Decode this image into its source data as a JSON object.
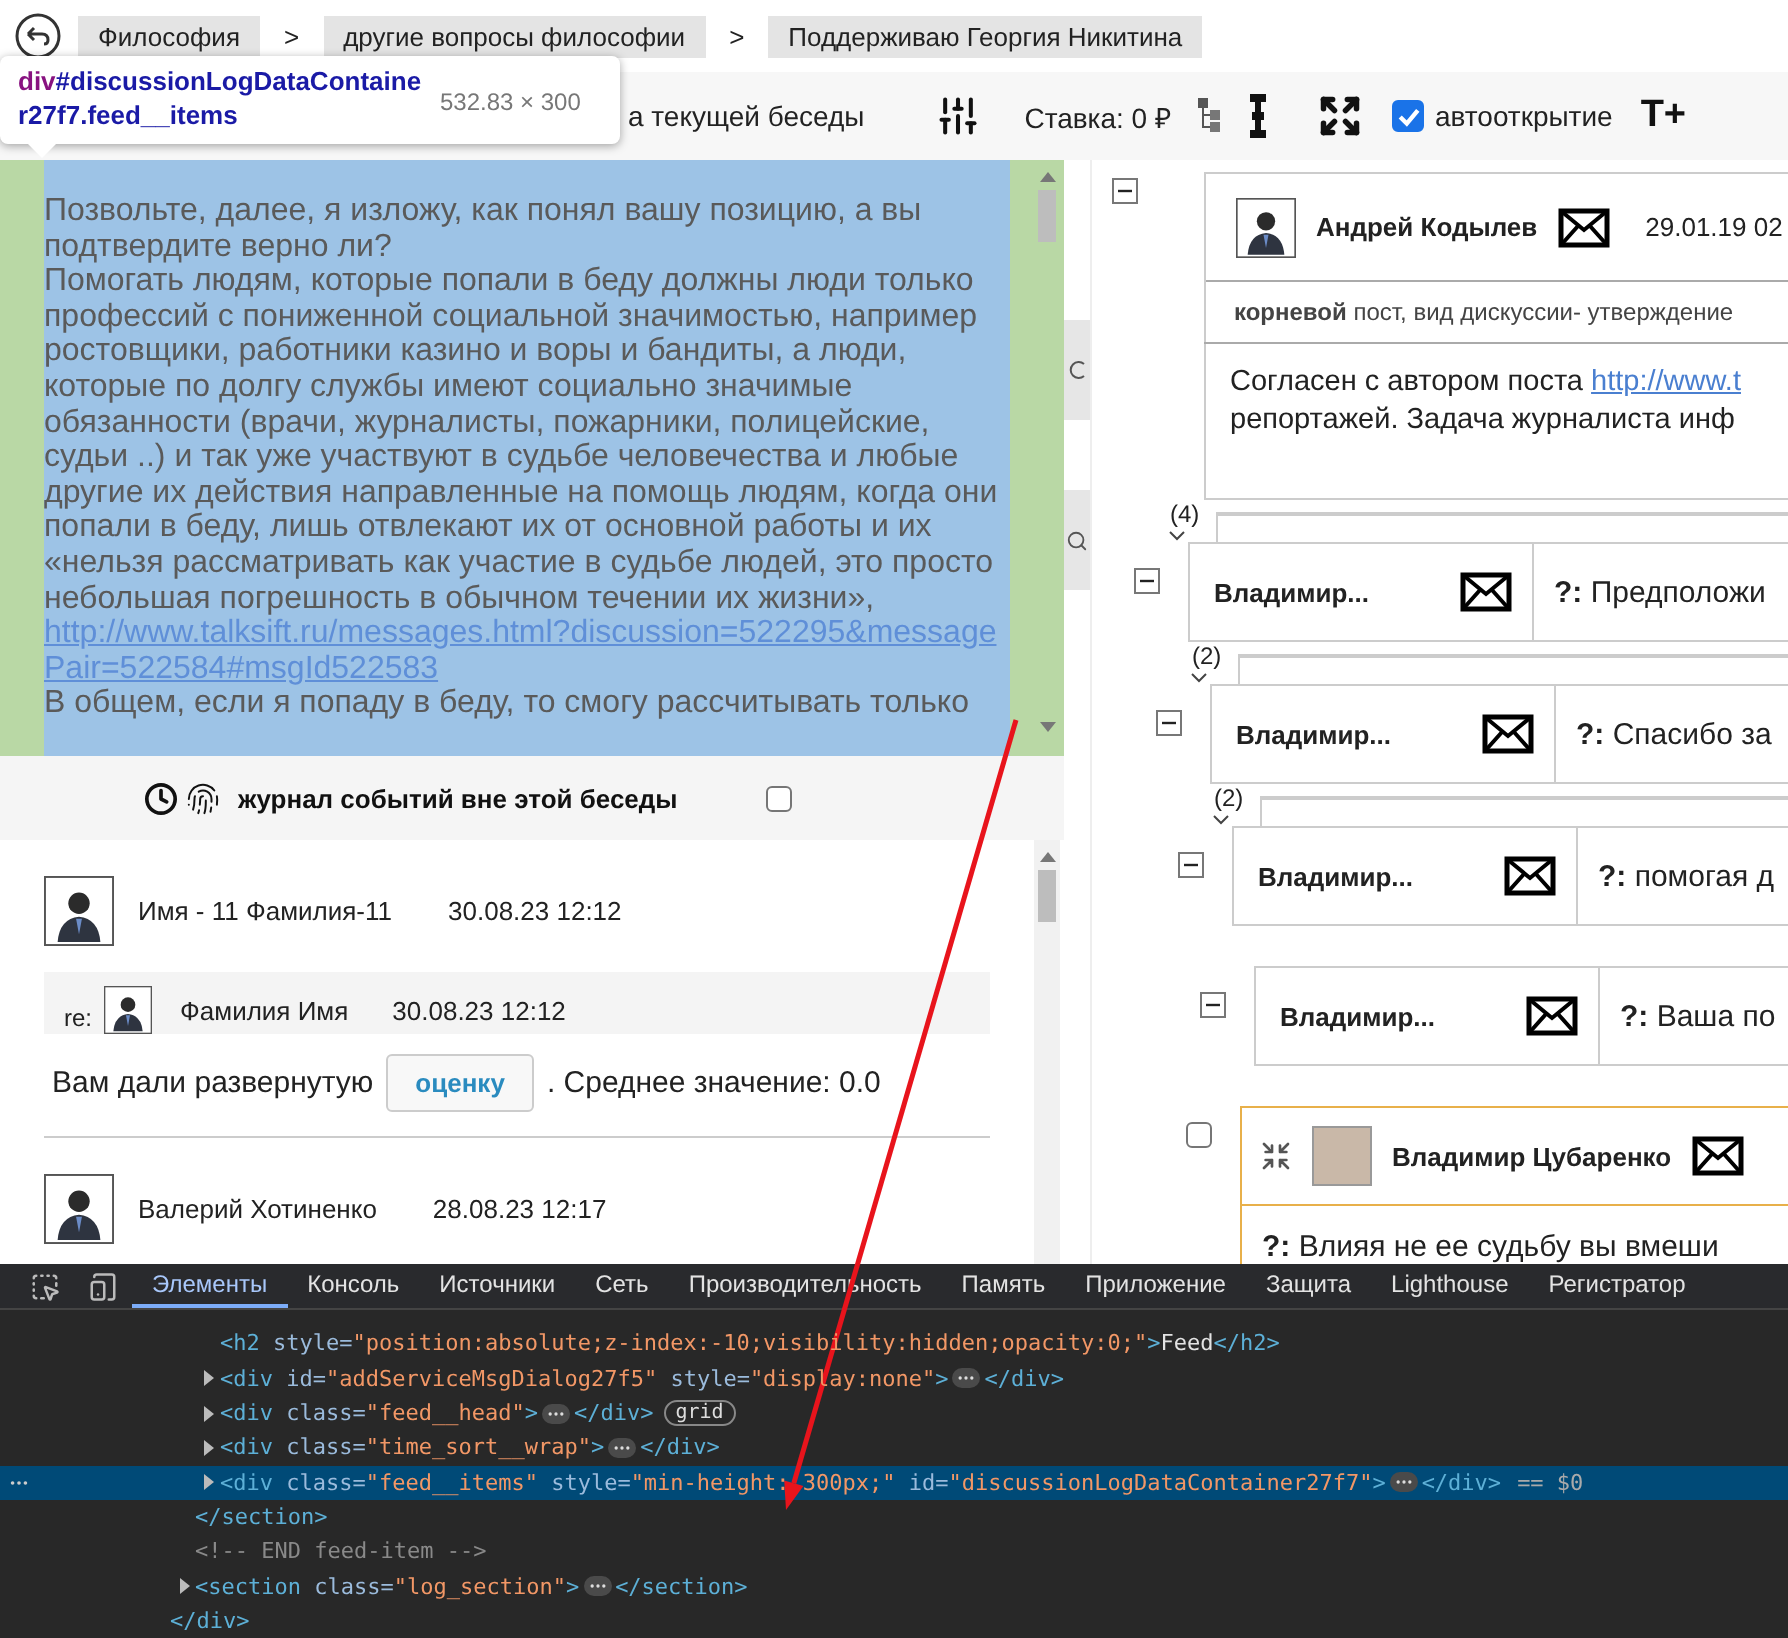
{
  "breadcrumbs": {
    "items": [
      "Философия",
      "другие вопросы философии",
      "Поддерживаю Георгия Никитина"
    ],
    "separator": ">"
  },
  "inspector_tooltip": {
    "tag": "div",
    "selector": "#discussionLogDataContainer27f7.feed__items",
    "size": "532.83 × 300"
  },
  "toolbar": {
    "label": "а текущей беседы",
    "stake": "Ставка: 0 ₽",
    "auto_open": {
      "label": "автооткрытие",
      "checked": true
    },
    "font_size_button": "T+"
  },
  "highlighted_message": {
    "lines": [
      {
        "kind": "text",
        "text": "Позвольте, далее, я изложу, как понял вашу позицию, а вы подтвердите верно ли?"
      },
      {
        "kind": "text",
        "text": "Помогать людям, которые попали в беду должны люди только профессий с пониженной социальной значимостью, например ростовщики, работники казино и воры и бандиты, а люди, которые по долгу службы имеют социально значимые обязанности (врачи, журналисты, пожарники, полицейские, судьи ..) и так уже участвуют в судьбе человечества и любые другие их действия направленные на помощь людям, когда они попали в беду, лишь отвлекают их от основной работы и их «нельзя рассматривать как участие в судьбе людей, это просто небольшая погрешность в обычном течении их жизни»,"
      },
      {
        "kind": "link",
        "text": "http://www.talksift.ru/messages.html?discussion=522295&messagePair=522584#msgId522583"
      },
      {
        "kind": "text",
        "text": "В общем, если я попаду в беду, то смогу рассчитывать только"
      }
    ]
  },
  "event_log": {
    "label": "журнал событий вне этой беседы",
    "checked": false
  },
  "feed": [
    {
      "author": "Имя - 11 Фамилия-11",
      "time": "30.08.23 12:12",
      "reply": {
        "prefix": "re:",
        "author": "Фамилия Имя",
        "time": "30.08.23 12:12"
      },
      "body": {
        "before": "Вам дали развернутую",
        "button": "оценку",
        "after": ". Среднее значение: 0.0"
      }
    },
    {
      "author": "Валерий Хотиненко",
      "time": "28.08.23 12:17"
    }
  ],
  "discussion_tree": {
    "root": {
      "expanded": true,
      "author": "Андрей Кодылев",
      "date": "29.01.19 02",
      "post_type": "**корневой** пост, вид дискуссии- утверждение",
      "text": "Согласен с автором поста",
      "link": "http://www.t",
      "text_2": "репортажей. Задача журналиста инф"
    },
    "replies": [
      {
        "kind": "compact",
        "expanded": true,
        "count": "(4)",
        "author": "Владимир...",
        "prefix": "?:",
        "text": "Предположи",
        "children": [
          {
            "kind": "compact",
            "expanded": true,
            "count": "(2)",
            "author": "Владимир...",
            "prefix": "?:",
            "text": "Спасибо за",
            "children": [
              {
                "kind": "compact",
                "expanded": true,
                "count": "(2)",
                "author": "Владимир...",
                "prefix": "?:",
                "text": "помогая д",
                "children": [
                  {
                    "kind": "compact",
                    "expanded": true,
                    "author": "Владимир...",
                    "prefix": "?:",
                    "text": "Ваша по",
                    "children": [
                      {
                        "kind": "card",
                        "checked": false,
                        "author": "Владимир Цубаренко",
                        "prefix": "?:",
                        "text": "Влияя не ее судьбу вы вмеши"
                      }
                    ]
                  }
                ]
              }
            ]
          }
        ]
      }
    ]
  },
  "devtools": {
    "tabs": [
      {
        "label": "Элементы",
        "selected": true
      },
      {
        "label": "Консоль",
        "selected": false
      },
      {
        "label": "Источники",
        "selected": false
      },
      {
        "label": "Сеть",
        "selected": false
      },
      {
        "label": "Производительность",
        "selected": false
      },
      {
        "label": "Память",
        "selected": false
      },
      {
        "label": "Приложение",
        "selected": false
      },
      {
        "label": "Защита",
        "selected": false
      },
      {
        "label": "Lighthouse",
        "selected": false
      },
      {
        "label": "Регистратор",
        "selected": false
      }
    ],
    "dom": {
      "children": [
        {
          "children": [
            {
              "open": "<h2 style=\"position:absolute;z-index:-10;visibility:hidden;opacity:0;\">",
              "content": "Feed",
              "close": "</h2>",
              "selected": false
            },
            {
              "open": "<div id=\"addServiceMsgDialog27f5\" style=\"display:none\">",
              "close": "</div>",
              "collapsed": true,
              "selected": false
            },
            {
              "open": "<div class=\"feed__head\">",
              "close": "</div>",
              "collapsed": true,
              "badge": "grid",
              "selected": false
            },
            {
              "open": "<div class=\"time_sort__wrap\">",
              "close": "</div>",
              "collapsed": true,
              "selected": false
            },
            {
              "open": "<div class=\"feed__items\" style=\"min-height: 300px;\" id=\"discussionLogDataContainer27f7\">",
              "close": "</div>",
              "collapsed": true,
              "selected": true,
              "suffix": "== $0"
            }
          ],
          "closing": "</section>"
        },
        {
          "comment": "<!-- END feed-item -->"
        },
        {
          "open": "<section class=\"log_section\">",
          "close": "</section>",
          "collapsed": true,
          "selected": false
        }
      ],
      "closing": "</div>"
    }
  }
}
